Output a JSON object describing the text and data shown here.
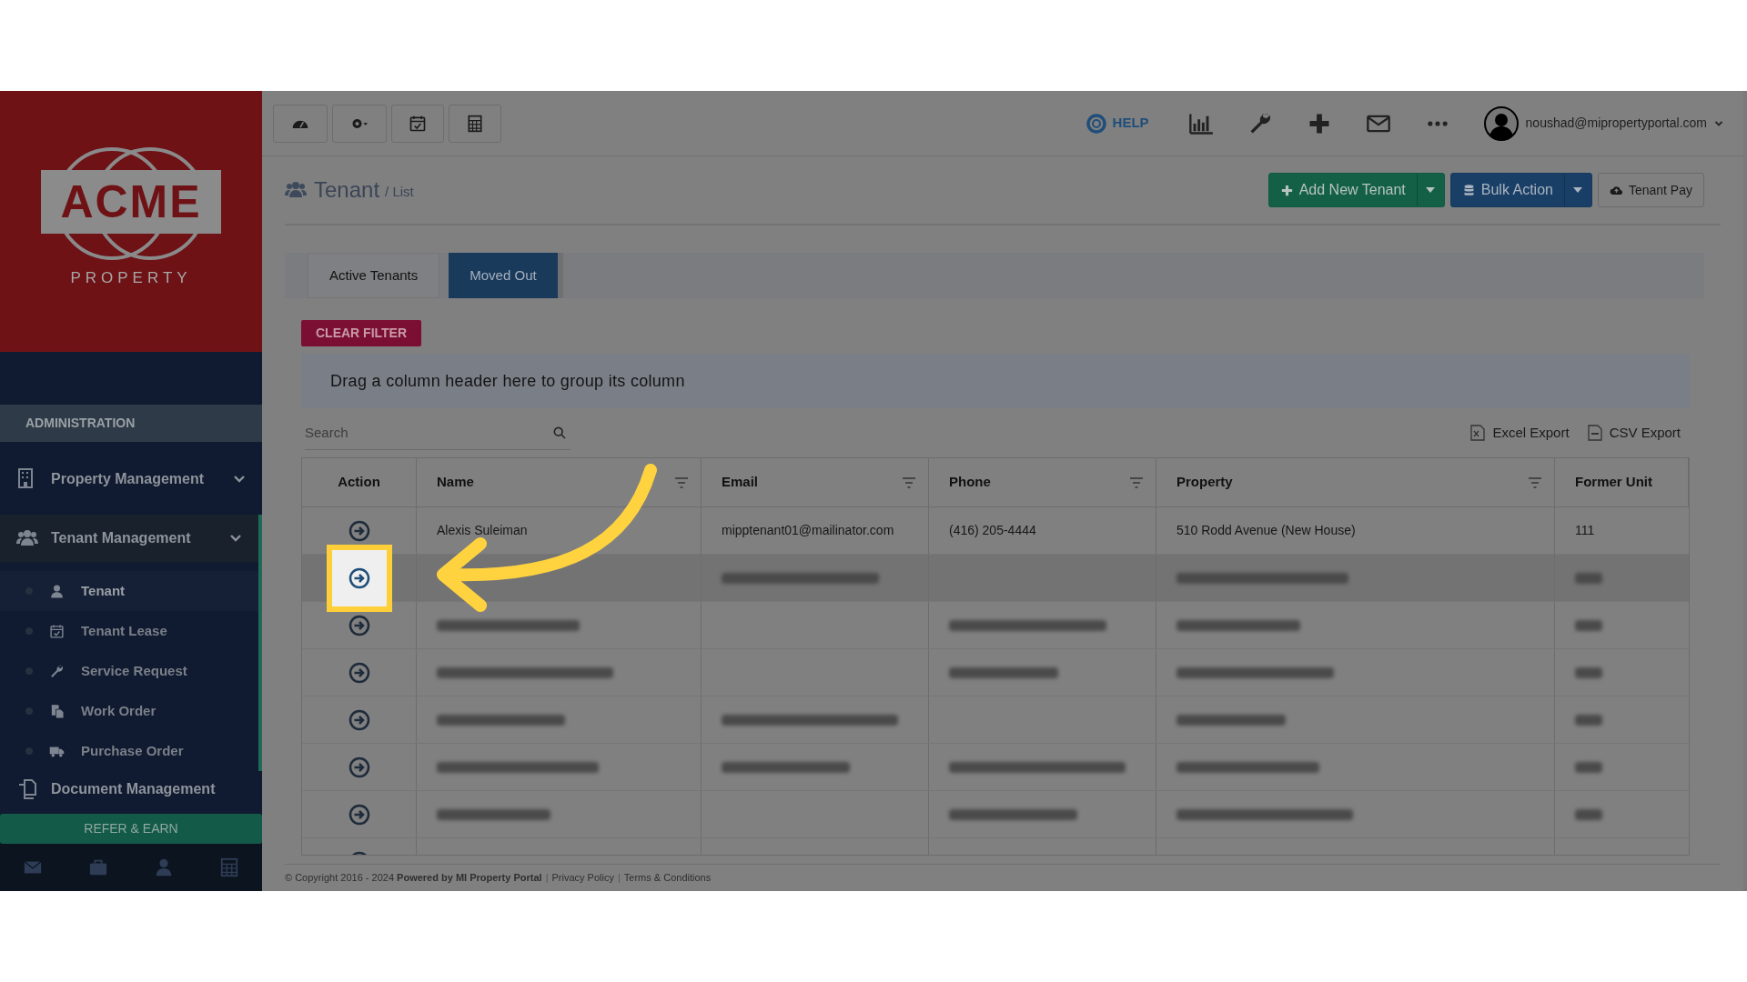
{
  "sidebar": {
    "logo": {
      "wordmark": "ACME",
      "tagline": "PROPERTY"
    },
    "section_label": "ADMINISTRATION",
    "items": [
      {
        "kind": "group",
        "label": "Property Management",
        "selected": false
      },
      {
        "kind": "group",
        "label": "Tenant Management",
        "selected": true,
        "children": [
          {
            "label": "Tenant",
            "selected": true
          },
          {
            "label": "Tenant Lease",
            "selected": false
          },
          {
            "label": "Service Request",
            "selected": false
          },
          {
            "label": "Work Order",
            "selected": false
          },
          {
            "label": "Purchase Order",
            "selected": false
          }
        ]
      },
      {
        "kind": "link",
        "label": "Document Management",
        "selected": false
      }
    ],
    "refer_button": "REFER & EARN"
  },
  "toolbar": {
    "help": "HELP",
    "user": "noushad@mipropertyportal.com"
  },
  "page_header": {
    "title": "Tenant",
    "subtitle": "/ List",
    "buttons": [
      {
        "label": "Add New Tenant",
        "kind": "success",
        "split": true
      },
      {
        "label": "Bulk Action",
        "kind": "primary",
        "split": true
      },
      {
        "label": "Tenant Pay",
        "kind": "default",
        "split": false
      }
    ]
  },
  "tabs": [
    {
      "label": "Active Tenants",
      "selected": false
    },
    {
      "label": "Moved Out",
      "selected": true
    }
  ],
  "clear_filter": "CLEAR FILTER",
  "group_panel": "Drag a column header here to group its column",
  "search": {
    "placeholder": "Search"
  },
  "exports": [
    {
      "label": "Excel Export",
      "kind": "excel"
    },
    {
      "label": "CSV Export",
      "kind": "csv"
    }
  ],
  "table": {
    "columns": [
      {
        "label": "Action",
        "filterable": false
      },
      {
        "label": "Name",
        "filterable": true
      },
      {
        "label": "Email",
        "filterable": true
      },
      {
        "label": "Phone",
        "filterable": true
      },
      {
        "label": "Property",
        "filterable": true
      },
      {
        "label": "Former Unit",
        "filterable": false
      }
    ],
    "rows": [
      {
        "cells": [
          "Alexis Suleiman",
          "mipptenant01@mailinator.com",
          "(416) 205-4444",
          "510 Rodd Avenue (New House)",
          "111"
        ],
        "highlighted": false
      },
      {
        "redacted": [
          false,
          true,
          false,
          true,
          true
        ],
        "highlighted": true
      },
      {
        "redacted": [
          true,
          false,
          true,
          true,
          true
        ],
        "highlighted": false
      },
      {
        "redacted": [
          true,
          false,
          true,
          true,
          true
        ],
        "highlighted": false
      },
      {
        "redacted": [
          true,
          true,
          false,
          true,
          true
        ],
        "highlighted": false
      },
      {
        "redacted": [
          true,
          true,
          true,
          true,
          true
        ],
        "highlighted": false
      },
      {
        "redacted": [
          true,
          false,
          true,
          true,
          true
        ],
        "highlighted": false
      },
      {
        "highlighted": false
      }
    ]
  },
  "footer": {
    "copyright": "© Copyright 2016 - 2024 **Powered by MI Property Portal**",
    "parts": [
      {
        "kind": "separator",
        "text": "|"
      },
      {
        "kind": "link",
        "text": "Privacy Policy"
      },
      {
        "kind": "separator",
        "text": "|"
      },
      {
        "kind": "link",
        "text": "Terms & Conditions"
      }
    ]
  }
}
